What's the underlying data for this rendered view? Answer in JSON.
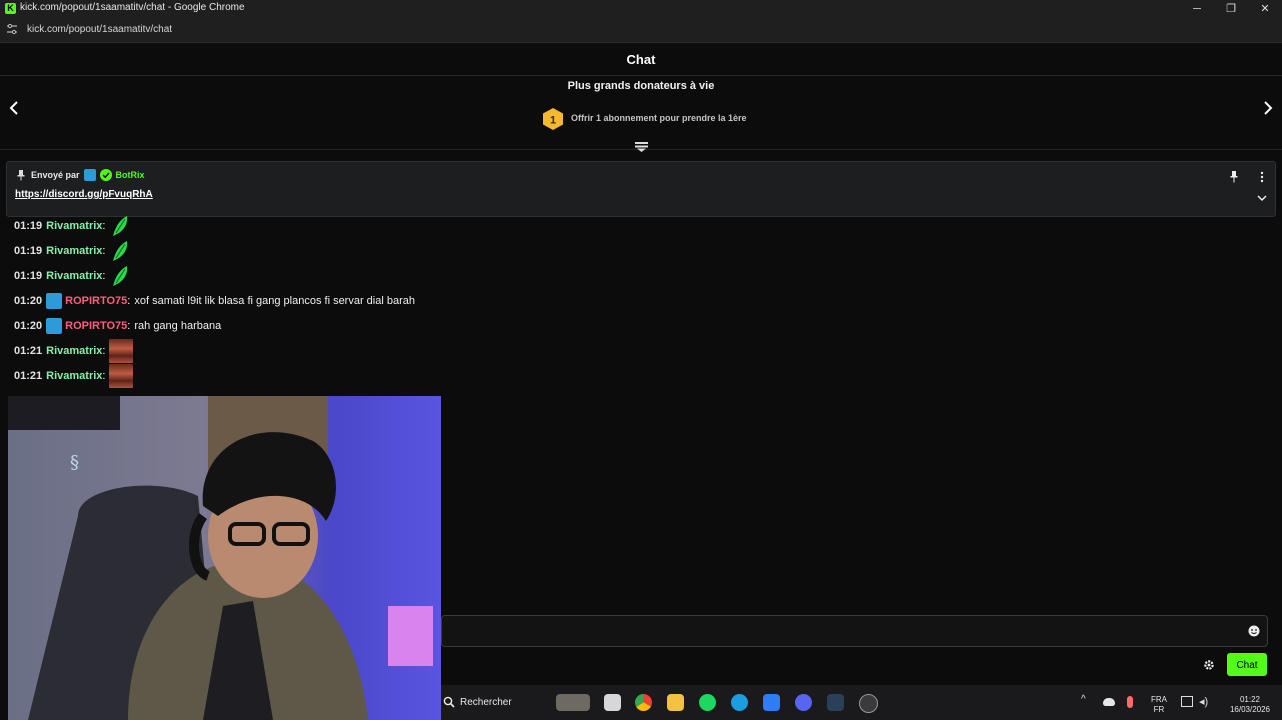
{
  "window": {
    "title": "kick.com/popout/1saamatitv/chat - Google Chrome",
    "controls": {
      "minimize": "─",
      "maximize": "❐",
      "close": "✕"
    }
  },
  "address_bar": {
    "url": "kick.com/popout/1saamatitv/chat"
  },
  "chat_header": {
    "title": "Chat"
  },
  "donors": {
    "title": "Plus grands donateurs à vie",
    "rank": "1",
    "offer_text": "Offrir 1 abonnement pour prendre la 1ère",
    "prev_icon": "chevron-left-icon",
    "next_icon": "chevron-right-icon"
  },
  "pinned": {
    "sent_by": "Envoyé par",
    "bot_name": "BotRix",
    "link": "https://discord.gg/pFvuqRhA"
  },
  "messages": [
    {
      "time": "01:19",
      "user": "Rivamatrix",
      "text": "",
      "emote": "green-leaf-emote",
      "badge": false,
      "color": "#86f0a8"
    },
    {
      "time": "01:19",
      "user": "Rivamatrix",
      "text": "",
      "emote": "green-leaf-emote",
      "badge": false,
      "color": "#86f0a8"
    },
    {
      "time": "01:19",
      "user": "Rivamatrix",
      "text": "",
      "emote": "green-leaf-emote",
      "badge": false,
      "color": "#86f0a8"
    },
    {
      "time": "01:20",
      "user": "ROPIRTO75",
      "text": "xof samati l9it lik blasa fi gang plancos fi servar dial barah",
      "emote": "",
      "badge": true,
      "color": "#ff5f7d"
    },
    {
      "time": "01:20",
      "user": "ROPIRTO75",
      "text": "rah gang harbana",
      "emote": "",
      "badge": true,
      "color": "#ff5f7d"
    },
    {
      "time": "01:21",
      "user": "Rivamatrix",
      "text": "",
      "emote": "face-photo-emote",
      "badge": false,
      "color": "#86f0a8"
    },
    {
      "time": "01:21",
      "user": "Rivamatrix",
      "text": "",
      "emote": "face-photo-emote",
      "badge": false,
      "color": "#86f0a8"
    }
  ],
  "chat_input": {
    "placeholder": "",
    "send_label": "Chat"
  },
  "taskbar": {
    "search_label": "Rechercher",
    "lang_top": "FRA",
    "lang_bottom": "FR",
    "time": "01:22",
    "date": "16/03/2026"
  },
  "colors": {
    "accent": "#53fc18",
    "pink_user": "#ff5f7d",
    "green_user": "#86f0a8"
  }
}
